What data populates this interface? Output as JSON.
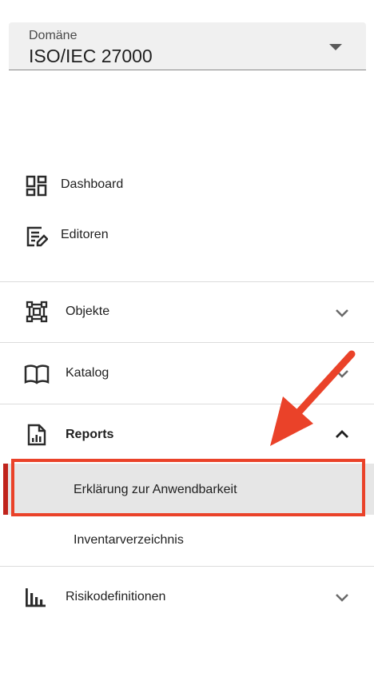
{
  "domain": {
    "label": "Domäne",
    "value": "ISO/IEC 27000"
  },
  "nav": {
    "dashboard": "Dashboard",
    "editors": "Editoren",
    "objects": "Objekte",
    "catalog": "Katalog",
    "reports": "Reports",
    "report_items": [
      "Erklärung zur Anwendbarkeit",
      "Inventarverzeichnis"
    ],
    "risk": "Risikodefinitionen"
  },
  "colors": {
    "accent": "#ea4229",
    "active_bar": "#c0241c",
    "active_bg": "#e6e6e6"
  },
  "icons": {
    "dashboard": "dashboard-icon",
    "editors": "edit-note-icon",
    "objects": "object-graph-icon",
    "catalog": "book-icon",
    "reports": "report-doc-icon",
    "risk": "bar-chart-icon"
  }
}
